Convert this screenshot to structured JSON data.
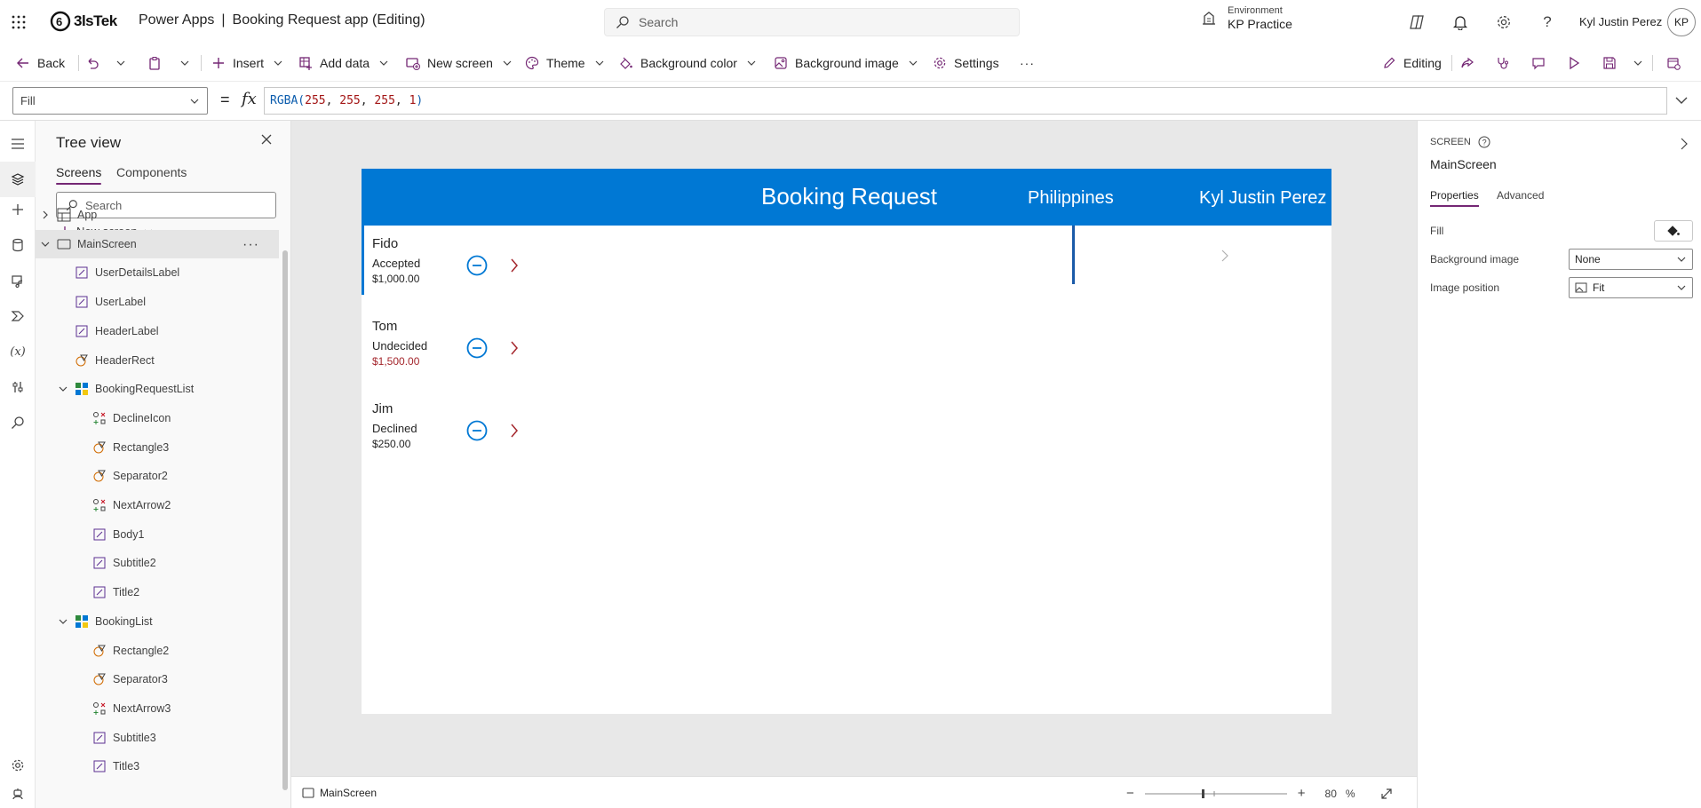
{
  "topbar": {
    "logo_text": "3lsTek",
    "app_name": "Power Apps",
    "separator": "|",
    "doc_title": "Booking Request app (Editing)",
    "search_placeholder": "Search",
    "environment_label": "Environment",
    "environment_value": "KP Practice",
    "user_name": "Kyl Justin Perez",
    "avatar_initials": "KP",
    "icons": [
      "waffle-icon",
      "environment-icon",
      "copilot-icon",
      "bell-icon",
      "gear-icon",
      "help-icon"
    ]
  },
  "commandbar": {
    "back": "Back",
    "insert": "Insert",
    "add_data": "Add data",
    "new_screen": "New screen",
    "theme": "Theme",
    "background_color": "Background color",
    "background_image": "Background image",
    "settings": "Settings",
    "more": "···",
    "editing": "Editing"
  },
  "formulabar": {
    "property": "Fill",
    "equals": "=",
    "fx": "fx",
    "formula_fn": "RGBA(",
    "formula_args": [
      "255",
      "255",
      "255",
      "1"
    ],
    "formula_close": ")"
  },
  "tree": {
    "title": "Tree view",
    "tabs": [
      "Screens",
      "Components"
    ],
    "active_tab": "Screens",
    "search_placeholder": "Search",
    "new_screen": "New screen",
    "nodes": [
      {
        "label": "App",
        "icon": "app-icon"
      },
      {
        "label": "MainScreen",
        "icon": "screen-icon",
        "selected": true
      },
      {
        "label": "UserDetailsLabel",
        "icon": "label-icon"
      },
      {
        "label": "UserLabel",
        "icon": "label-icon"
      },
      {
        "label": "HeaderLabel",
        "icon": "label-icon"
      },
      {
        "label": "HeaderRect",
        "icon": "shape-icon"
      },
      {
        "label": "BookingRequestList",
        "icon": "gallery-icon"
      },
      {
        "label": "DeclineIcon",
        "icon": "icon-icon"
      },
      {
        "label": "Rectangle3",
        "icon": "shape-icon"
      },
      {
        "label": "Separator2",
        "icon": "shape-icon"
      },
      {
        "label": "NextArrow2",
        "icon": "icon-icon"
      },
      {
        "label": "Body1",
        "icon": "label-icon"
      },
      {
        "label": "Subtitle2",
        "icon": "label-icon"
      },
      {
        "label": "Title2",
        "icon": "label-icon"
      },
      {
        "label": "BookingList",
        "icon": "gallery-icon"
      },
      {
        "label": "Rectangle2",
        "icon": "shape-icon"
      },
      {
        "label": "Separator3",
        "icon": "shape-icon"
      },
      {
        "label": "NextArrow3",
        "icon": "icon-icon"
      },
      {
        "label": "Subtitle3",
        "icon": "label-icon"
      },
      {
        "label": "Title3",
        "icon": "label-icon"
      }
    ]
  },
  "app": {
    "header_title": "Booking Request",
    "user_location": "Philippines",
    "user_name": "Kyl Justin Perez",
    "header_color": "#0078d4",
    "bookings": [
      {
        "name": "Fido",
        "status": "Accepted",
        "amount": "$1,000.00",
        "amount_red": false
      },
      {
        "name": "Tom",
        "status": "Undecided",
        "amount": "$1,500.00",
        "amount_red": true
      },
      {
        "name": "Jim",
        "status": "Declined",
        "amount": "$250.00",
        "amount_red": false
      }
    ]
  },
  "statusbar": {
    "screen_name": "MainScreen",
    "zoom_value": "80",
    "zoom_unit": "%",
    "zoom_minus": "−",
    "zoom_plus": "+"
  },
  "properties": {
    "kind": "SCREEN",
    "screen_name": "MainScreen",
    "tabs": [
      "Properties",
      "Advanced"
    ],
    "fill_label": "Fill",
    "background_image_label": "Background image",
    "background_image_value": "None",
    "image_position_label": "Image position",
    "image_position_value": "Fit"
  },
  "colors": {
    "accent": "#742774",
    "header_blue": "#0078d4",
    "icon_blue": "#0078d4",
    "arrow_red": "#a4262c"
  }
}
